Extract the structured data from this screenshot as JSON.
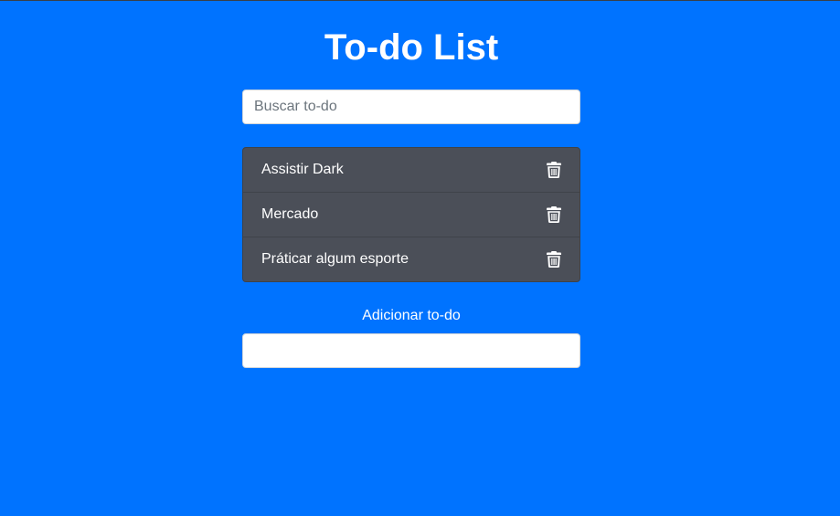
{
  "header": {
    "title": "To-do List"
  },
  "search": {
    "placeholder": "Buscar to-do",
    "value": ""
  },
  "todos": [
    {
      "text": "Assistir Dark",
      "icon": "trash-icon"
    },
    {
      "text": "Mercado",
      "icon": "trash-icon"
    },
    {
      "text": "Práticar algum esporte",
      "icon": "trash-icon"
    }
  ],
  "add_form": {
    "label": "Adicionar to-do",
    "value": ""
  },
  "colors": {
    "background": "#0073ff",
    "list_background": "#4b4f58",
    "text": "#ffffff"
  }
}
